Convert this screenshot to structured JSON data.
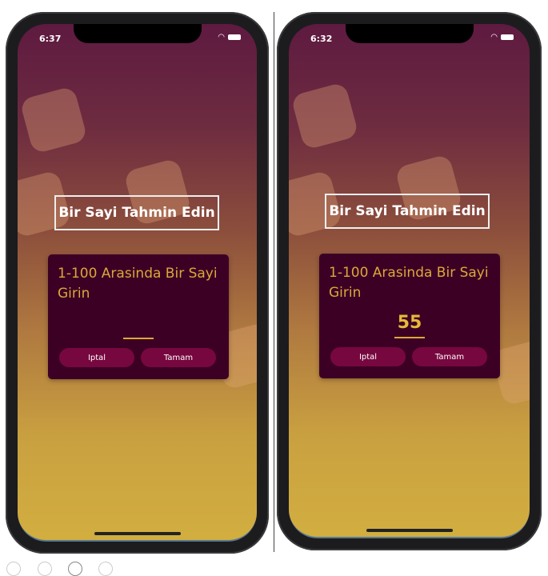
{
  "screens": [
    {
      "time": "6:37",
      "title": "Bir Sayi Tahmin Edin",
      "prompt": "1-100 Arasinda Bir Sayi Girin",
      "input_value": "",
      "cancel": "Iptal",
      "ok": "Tamam"
    },
    {
      "time": "6:32",
      "title": "Bir Sayi Tahmin Edin",
      "prompt": "1-100 Arasinda Bir Sayi Girin",
      "input_value": "55",
      "cancel": "Iptal",
      "ok": "Tamam"
    }
  ]
}
